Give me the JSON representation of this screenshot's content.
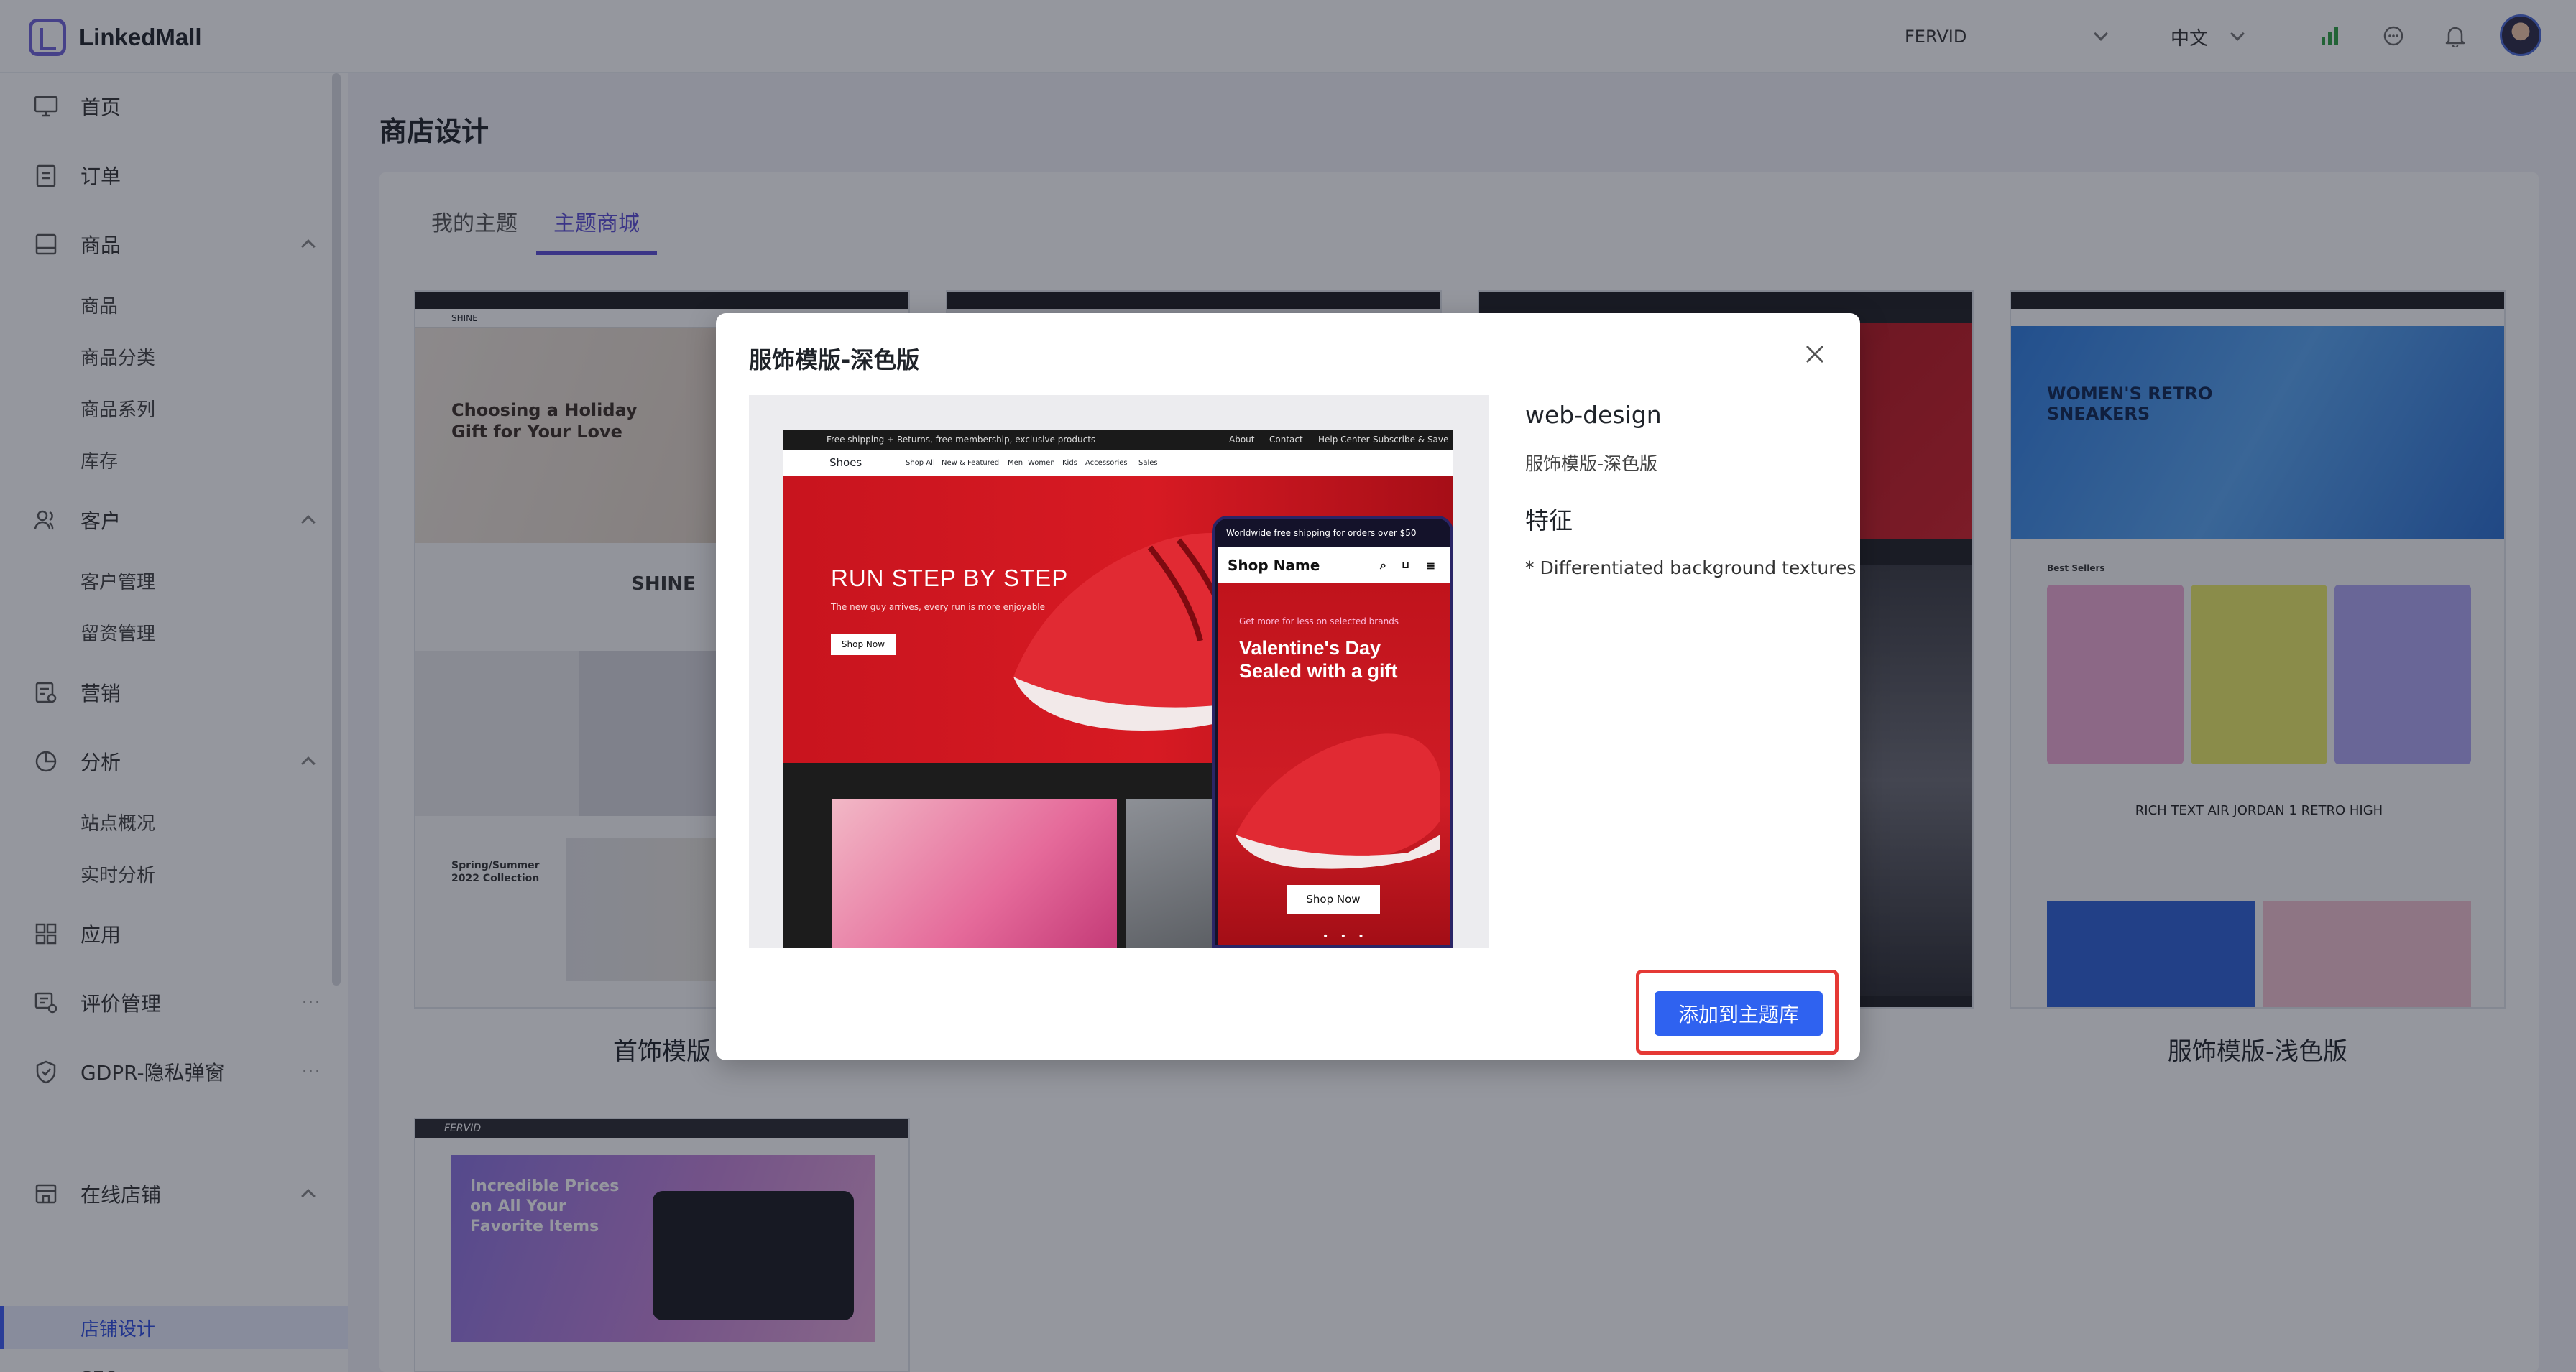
{
  "app": {
    "name": "LinkedMall"
  },
  "header": {
    "store": "FERVID",
    "language": "中文"
  },
  "sidebar": {
    "items": [
      {
        "label": "首页"
      },
      {
        "label": "订单"
      },
      {
        "label": "商品",
        "children": [
          "商品",
          "商品分类",
          "商品系列",
          "库存"
        ]
      },
      {
        "label": "客户",
        "children": [
          "客户管理",
          "留资管理"
        ]
      },
      {
        "label": "营销"
      },
      {
        "label": "分析",
        "children": [
          "站点概况",
          "实时分析"
        ]
      },
      {
        "label": "应用"
      },
      {
        "label": "评价管理"
      },
      {
        "label": "GDPR-隐私弹窗"
      },
      {
        "label": "在线店铺",
        "children": [
          "店铺设计",
          "SEO"
        ]
      }
    ],
    "active": "店铺设计"
  },
  "page": {
    "title": "商店设计",
    "tabs": [
      {
        "label": "我的主题"
      },
      {
        "label": "主题商城"
      }
    ],
    "active_tab": "主题商城",
    "cards": [
      {
        "name": "首饰模版",
        "hero_title": "Choosing a Holiday Gift for Your Love",
        "brand": "SHINE",
        "collection": "Spring/Summer 2022 Collection"
      },
      {
        "name": "服饰模版-浅色版",
        "hero_title": "WOMEN'S RETRO SNEAKERS",
        "section": "Best Sellers",
        "feature": "RICH TEXT AIR JORDAN 1 RETRO HIGH"
      },
      {
        "hero_title": "Incredible Prices on All Your Favorite Items",
        "brand": "FERVID"
      }
    ]
  },
  "modal": {
    "title": "服饰模版-深色版",
    "template_name": "web-design",
    "subtitle": "服饰模版-深色版",
    "features_heading": "特征",
    "features": [
      "* Differentiated background textures"
    ],
    "add_button": "添加到主题库",
    "preview": {
      "topbar_text": "Free shipping + Returns, free membership, exclusive products",
      "topbar_links": [
        "About",
        "Contact",
        "Help Center",
        "Subscribe & Save"
      ],
      "nav_brand": "Shoes",
      "nav_links": [
        "Shop All",
        "New & Featured",
        "Men",
        "Women",
        "Kids",
        "Accessories",
        "Sales"
      ],
      "hero_title": "RUN STEP BY STEP",
      "hero_sub": "The new guy arrives, every run is more enjoyable",
      "hero_button": "Shop Now",
      "phone_top": "Worldwide free shipping for orders over $50",
      "phone_shop": "Shop Name",
      "phone_kicker": "Get more for less on selected brands",
      "phone_title": "Valentine's Day Sealed with a gift",
      "phone_button": "Shop Now"
    }
  }
}
